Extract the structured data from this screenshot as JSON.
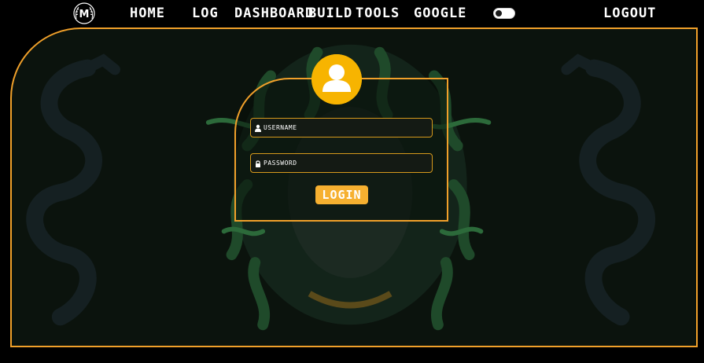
{
  "nav": {
    "logo_letter": "M",
    "links": [
      {
        "label": "HOME"
      },
      {
        "label": "LOG"
      },
      {
        "label": "DASHBOARD"
      },
      {
        "label": "BUILD"
      },
      {
        "label": "TOOLS"
      },
      {
        "label": "GOOGLE"
      }
    ],
    "theme_toggle_on": false,
    "logout_label": "LOGOUT"
  },
  "login": {
    "username_placeholder": "USERNAME",
    "password_placeholder": "PASSWORD",
    "submit_label": "LOGIN"
  },
  "icons": {
    "logo": "laurel-m-logo-icon",
    "avatar": "user-avatar-icon",
    "username": "user-icon",
    "password": "lock-icon",
    "background_left": "serpent-icon",
    "background_right": "serpent-icon",
    "background_center": "medusa-head-icon"
  },
  "colors": {
    "accent": "#f0a02a",
    "avatar_bg": "#f7b400",
    "button_bg": "#f6b030",
    "frame_bg": "#0b130d",
    "snake_green": "#1f4a2a"
  }
}
